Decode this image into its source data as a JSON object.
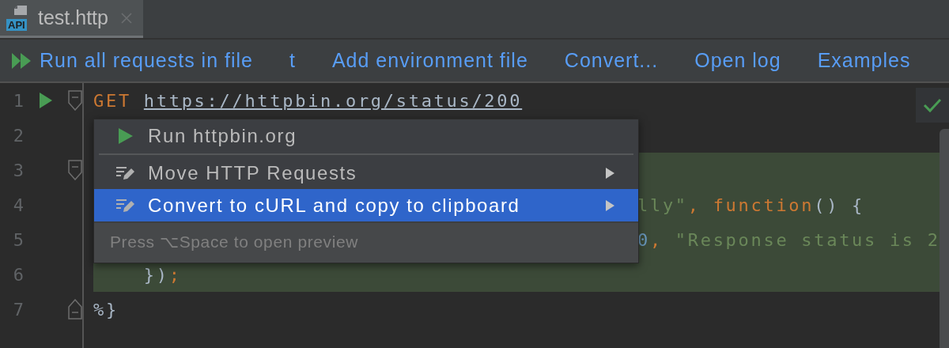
{
  "tab": {
    "title": "test.http",
    "badge": "API",
    "selected": true
  },
  "toolbar": {
    "actions": [
      {
        "label": "Run all requests in file",
        "kind": "run"
      },
      {
        "label": "t",
        "kind": "link"
      },
      {
        "label": "Add environment file",
        "kind": "link"
      },
      {
        "label": "Convert...",
        "kind": "link"
      },
      {
        "label": "Open log",
        "kind": "link"
      },
      {
        "label": "Examples",
        "kind": "link"
      }
    ]
  },
  "editor": {
    "inspection_ok": true,
    "lines": [
      {
        "number": "1",
        "run": true,
        "fold_start": true,
        "fold_end": false,
        "highlighted": false,
        "partial": false,
        "segments": [
          {
            "kind": "keyword",
            "text": "GET"
          },
          {
            "kind": "url",
            "text": "https://httpbin.org/status/200"
          }
        ]
      },
      {
        "number": "2",
        "run": false,
        "fold_start": false,
        "fold_end": false,
        "highlighted": false
      },
      {
        "number": "3",
        "run": false,
        "fold_start": true,
        "fold_end": false,
        "highlighted": true
      },
      {
        "number": "4",
        "run": false,
        "fold_start": false,
        "fold_end": false,
        "highlighted": true,
        "partial": true,
        "segments": [
          {
            "kind": "string",
            "text": "lly\""
          },
          {
            "kind": "punct",
            "text": ", "
          },
          {
            "kind": "keyword",
            "text": "function"
          },
          {
            "kind": "plain",
            "text": "() {"
          }
        ]
      },
      {
        "number": "5",
        "run": false,
        "fold_start": false,
        "fold_end": false,
        "highlighted": true,
        "partial": true,
        "segments": [
          {
            "kind": "number",
            "text": "0"
          },
          {
            "kind": "punct",
            "text": ", "
          },
          {
            "kind": "string",
            "text": "\"Response status is 2"
          }
        ]
      },
      {
        "number": "6",
        "run": false,
        "fold_start": false,
        "fold_end": false,
        "highlighted": true,
        "partial": false,
        "segments": [
          {
            "kind": "plain",
            "text": "    })"
          },
          {
            "kind": "punct",
            "text": ";"
          }
        ]
      },
      {
        "number": "7",
        "run": false,
        "fold_start": false,
        "fold_end": true,
        "highlighted": false,
        "partial": false,
        "segments": [
          {
            "kind": "plain",
            "text": "%}"
          }
        ]
      }
    ]
  },
  "popup": {
    "groups": [
      [
        {
          "label": "Run httpbin.org",
          "kind": "run",
          "submenu": false,
          "selected": false
        }
      ],
      [
        {
          "label": "Move HTTP Requests",
          "kind": "edit",
          "submenu": true,
          "selected": false
        },
        {
          "label": "Convert to cURL and copy to clipboard",
          "kind": "edit",
          "submenu": true,
          "selected": true
        }
      ]
    ],
    "hint": "Press ⌥Space to open preview"
  }
}
